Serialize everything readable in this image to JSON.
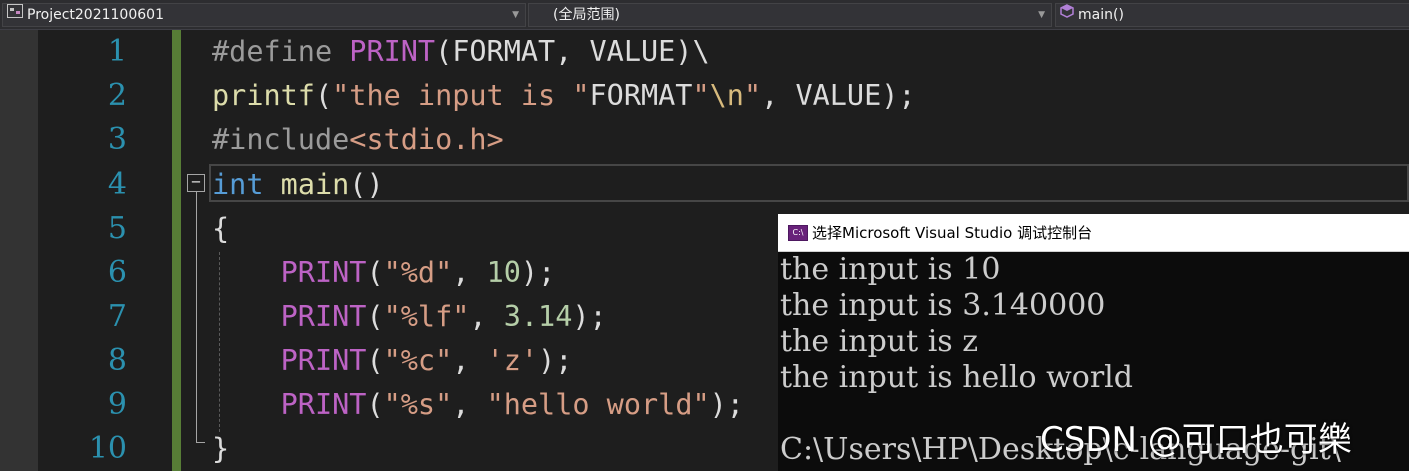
{
  "navbar": {
    "project": "Project2021100601",
    "scope": "(全局范围)",
    "member": "main()"
  },
  "editor": {
    "line_numbers": [
      "1",
      "2",
      "3",
      "4",
      "5",
      "6",
      "7",
      "8",
      "9",
      "10"
    ],
    "fold_symbol": "−",
    "lines": [
      [
        {
          "t": "#define",
          "c": "pp"
        },
        {
          "t": " ",
          "c": "plain"
        },
        {
          "t": "PRINT",
          "c": "macro"
        },
        {
          "t": "(FORMAT, VALUE)\\",
          "c": "plain"
        }
      ],
      [
        {
          "t": "printf",
          "c": "fn"
        },
        {
          "t": "(",
          "c": "plain"
        },
        {
          "t": "\"the input is \"",
          "c": "str"
        },
        {
          "t": "FORMAT",
          "c": "plain"
        },
        {
          "t": "\"",
          "c": "str"
        },
        {
          "t": "\\n",
          "c": "esc"
        },
        {
          "t": "\"",
          "c": "str"
        },
        {
          "t": ", VALUE);",
          "c": "plain"
        }
      ],
      [
        {
          "t": "#include",
          "c": "pp"
        },
        {
          "t": "<stdio.h>",
          "c": "str"
        }
      ],
      [
        {
          "t": "int",
          "c": "kw"
        },
        {
          "t": " ",
          "c": "plain"
        },
        {
          "t": "main",
          "c": "fn"
        },
        {
          "t": "()",
          "c": "plain"
        }
      ],
      [
        {
          "t": "{",
          "c": "plain"
        }
      ],
      [
        {
          "t": "    ",
          "c": "plain"
        },
        {
          "t": "PRINT",
          "c": "macro"
        },
        {
          "t": "(",
          "c": "plain"
        },
        {
          "t": "\"%d\"",
          "c": "str"
        },
        {
          "t": ", ",
          "c": "plain"
        },
        {
          "t": "10",
          "c": "num"
        },
        {
          "t": ");",
          "c": "plain"
        }
      ],
      [
        {
          "t": "    ",
          "c": "plain"
        },
        {
          "t": "PRINT",
          "c": "macro"
        },
        {
          "t": "(",
          "c": "plain"
        },
        {
          "t": "\"%lf\"",
          "c": "str"
        },
        {
          "t": ", ",
          "c": "plain"
        },
        {
          "t": "3.14",
          "c": "num"
        },
        {
          "t": ");",
          "c": "plain"
        }
      ],
      [
        {
          "t": "    ",
          "c": "plain"
        },
        {
          "t": "PRINT",
          "c": "macro"
        },
        {
          "t": "(",
          "c": "plain"
        },
        {
          "t": "\"%c\"",
          "c": "str"
        },
        {
          "t": ", ",
          "c": "plain"
        },
        {
          "t": "'z'",
          "c": "str"
        },
        {
          "t": ");",
          "c": "plain"
        }
      ],
      [
        {
          "t": "    ",
          "c": "plain"
        },
        {
          "t": "PRINT",
          "c": "macro"
        },
        {
          "t": "(",
          "c": "plain"
        },
        {
          "t": "\"%s\"",
          "c": "str"
        },
        {
          "t": ", ",
          "c": "plain"
        },
        {
          "t": "\"hello world\"",
          "c": "str"
        },
        {
          "t": ");",
          "c": "plain"
        }
      ],
      [
        {
          "t": "}",
          "c": "plain"
        }
      ]
    ]
  },
  "console": {
    "icon_text": "C:\\",
    "title": "选择Microsoft Visual Studio 调试控制台",
    "lines": [
      "the input is 10",
      "the input is 3.140000",
      "the input is z",
      "the input is hello world",
      "",
      "C:\\Users\\HP\\Desktop\\c-language-git\\"
    ]
  },
  "watermark": "CSDN @可口也可樂",
  "colors": {
    "background": "#1e1e1e",
    "line_number": "#2b91af",
    "change_bar": "#577d36",
    "macro": "#bd63c5",
    "preprocessor": "#9b9b9b",
    "string": "#d69d85",
    "keyword": "#569cd6",
    "function": "#dcdcaa",
    "number": "#b5cea8",
    "escape": "#d7ba7d",
    "console_bg": "#0c0c0c",
    "console_text": "#cccccc"
  }
}
